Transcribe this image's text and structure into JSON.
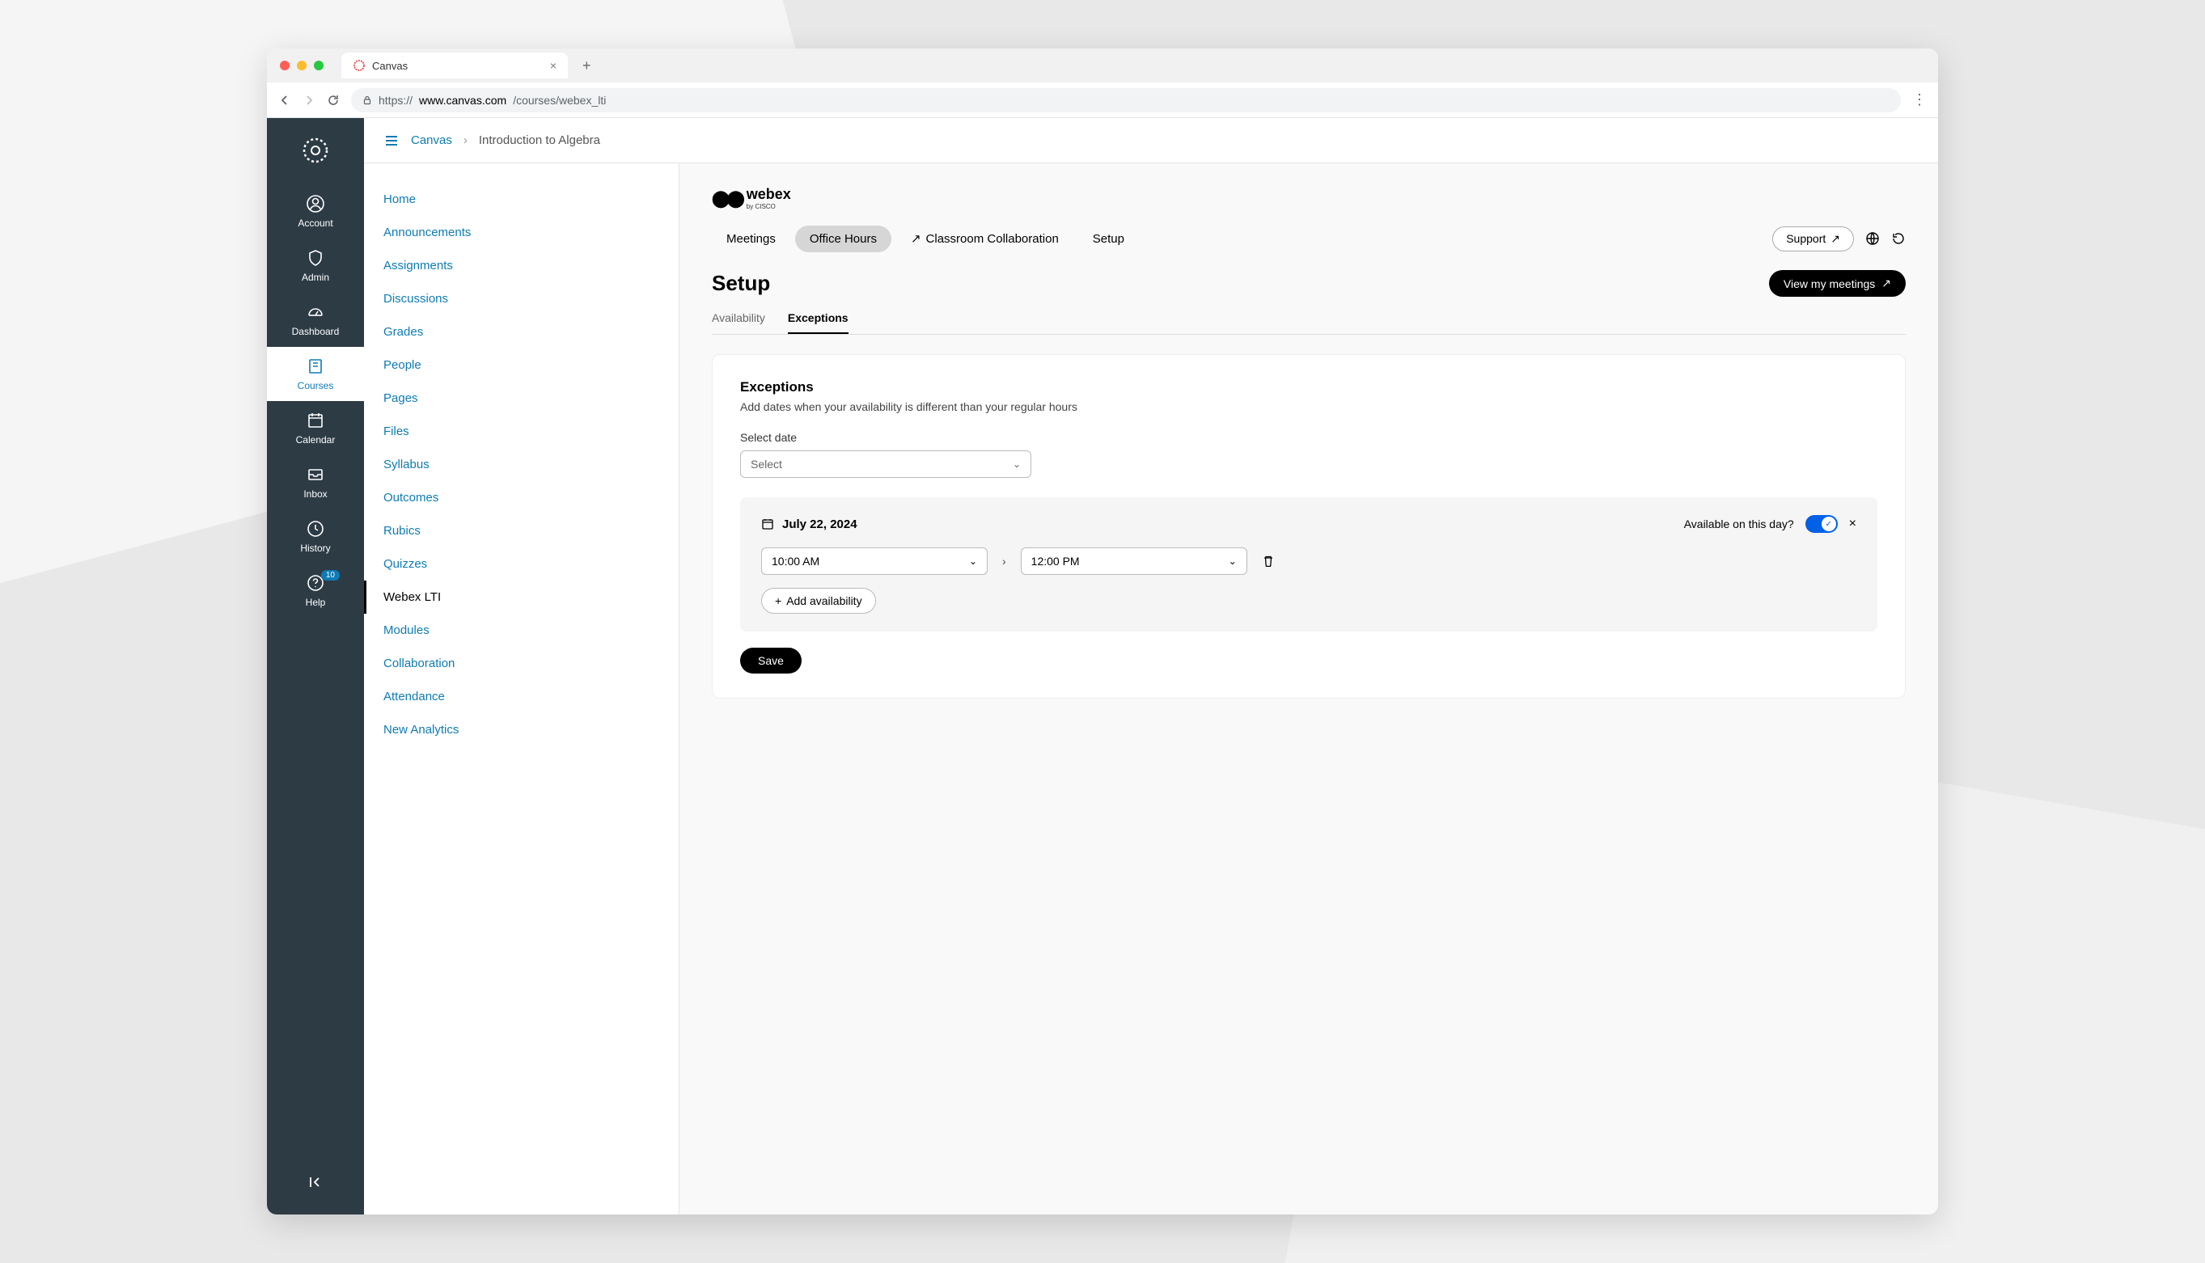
{
  "browser": {
    "tab_title": "Canvas",
    "url_prefix": "https://",
    "url_domain": "www.canvas.com",
    "url_path": "/courses/webex_lti"
  },
  "global_nav": {
    "items": [
      {
        "label": "Account"
      },
      {
        "label": "Admin"
      },
      {
        "label": "Dashboard"
      },
      {
        "label": "Courses"
      },
      {
        "label": "Calendar"
      },
      {
        "label": "Inbox"
      },
      {
        "label": "History"
      },
      {
        "label": "Help"
      }
    ],
    "help_badge": "10"
  },
  "breadcrumb": {
    "root": "Canvas",
    "current": "Introduction to Algebra"
  },
  "course_nav": [
    "Home",
    "Announcements",
    "Assignments",
    "Discussions",
    "Grades",
    "People",
    "Pages",
    "Files",
    "Syllabus",
    "Outcomes",
    "Rubics",
    "Quizzes",
    "Webex LTI",
    "Modules",
    "Collaboration",
    "Attendance",
    "New Analytics"
  ],
  "course_nav_active_index": 12,
  "webex": {
    "brand": "webex",
    "brand_sub": "by CISCO",
    "tabs": [
      "Meetings",
      "Office Hours",
      "Classroom Collaboration",
      "Setup"
    ],
    "active_tab_index": 1,
    "support_label": "Support",
    "setup_title": "Setup",
    "view_meetings_label": "View my meetings",
    "sub_tabs": [
      "Availability",
      "Exceptions"
    ],
    "active_sub_tab_index": 1
  },
  "exceptions": {
    "heading": "Exceptions",
    "description": "Add dates when your availability is different than your regular hours",
    "select_date_label": "Select date",
    "select_placeholder": "Select",
    "date": "July 22, 2024",
    "available_label": "Available on this day?",
    "available_toggle": true,
    "start_time": "10:00 AM",
    "end_time": "12:00 PM",
    "add_availability_label": "Add availability",
    "save_label": "Save"
  }
}
